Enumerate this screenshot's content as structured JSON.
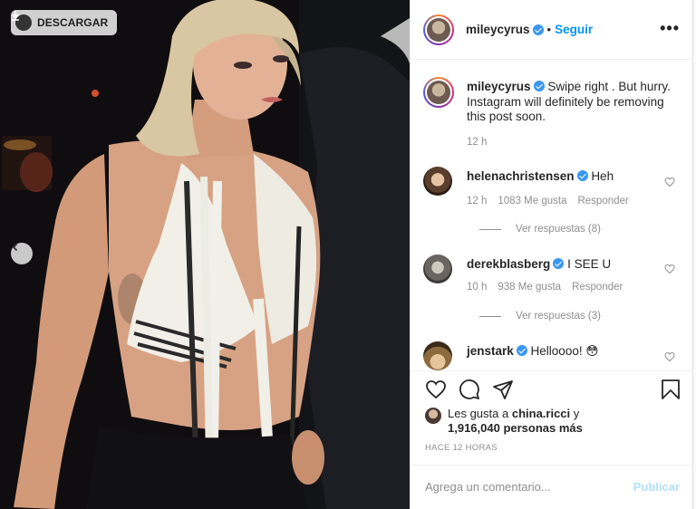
{
  "photo": {
    "download_label": "DESCARGAR",
    "icons": {
      "download": "download-icon",
      "prev": "chevron-left-icon"
    }
  },
  "post_header": {
    "username": "mileycyrus",
    "separator": "•",
    "follow_label": "Seguir",
    "more": "more-options-icon"
  },
  "caption": {
    "username": "mileycyrus",
    "text": "Swipe right . But hurry. Instagram will definitely be removing this post soon.",
    "time": "12 h"
  },
  "comments": [
    {
      "username": "helenachristensen",
      "text": "Heh",
      "time": "12 h",
      "likes": "1083 Me gusta",
      "reply": "Responder",
      "view_replies": "Ver respuestas (8)"
    },
    {
      "username": "derekblasberg",
      "text": "I SEE U",
      "time": "10 h",
      "likes": "938 Me gusta",
      "reply": "Responder",
      "view_replies": "Ver respuestas (3)"
    },
    {
      "username": "jenstark",
      "text": "Helloooo! 😳"
    }
  ],
  "actions": {
    "icons": [
      "heart-icon",
      "comment-icon",
      "share-icon",
      "bookmark-icon"
    ],
    "likes_prefix": "Les gusta a",
    "likes_user": "china.ricci",
    "likes_conj": "y",
    "likes_count": "1,916,040 personas más",
    "time_ago": "HACE 12 HORAS"
  },
  "add_comment": {
    "placeholder": "Agrega un comentario...",
    "publish_label": "Publicar"
  },
  "colors": {
    "link_blue": "#0095f6",
    "verified_blue": "#3897f0",
    "muted": "#8e8e8e",
    "publish_disabled": "#b2dffc"
  }
}
